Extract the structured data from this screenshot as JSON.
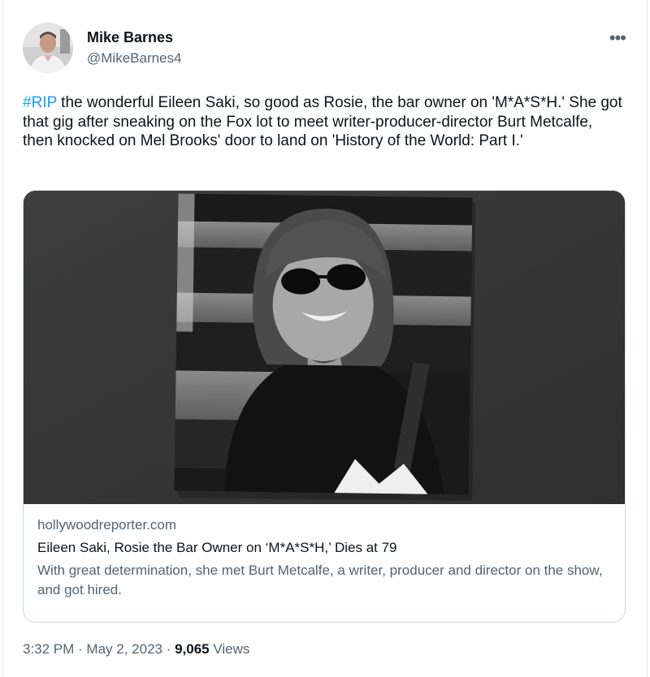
{
  "author": {
    "name": "Mike Barnes",
    "handle": "@MikeBarnes4"
  },
  "more_icon": "more-horizontal-icon",
  "tweet": {
    "hashtag": "#RIP",
    "body": " the wonderful Eileen Saki, so good as Rosie, the bar owner on 'M*A*S*H.' She got that gig after sneaking on the Fox lot to meet writer-producer-director Burt Metcalfe, then knocked on Mel Brooks' door to land on 'History of the World: Part I.'"
  },
  "card": {
    "domain": "hollywoodreporter.com",
    "title": "Eileen Saki, Rosie the Bar Owner on ‘M*A*S*H,’ Dies at 79",
    "description": "With great determination, she met Burt Metcalfe, a writer, producer and director on the show, and got hired."
  },
  "meta": {
    "time": "3:32 PM",
    "sep1": " · ",
    "date": "May 2, 2023",
    "sep2": " · ",
    "views_count": "9,065",
    "views_label": " Views"
  },
  "colors": {
    "accent": "#1d9bf0",
    "secondary_text": "#536471",
    "primary_text": "#0f1419",
    "border": "#cfd9de"
  }
}
